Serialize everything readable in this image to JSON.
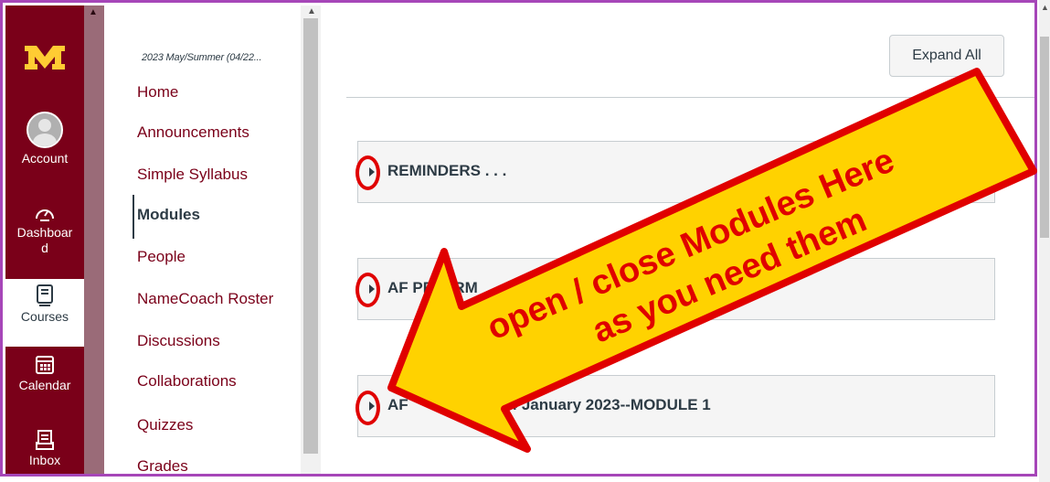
{
  "global_nav": {
    "account": "Account",
    "dashboard": "Dashboard",
    "courses": "Courses",
    "calendar": "Calendar",
    "inbox": "Inbox"
  },
  "course_nav": {
    "term": "2023 May/Summer (04/22...",
    "items": [
      {
        "label": "Home"
      },
      {
        "label": "Announcements"
      },
      {
        "label": "Simple Syllabus"
      },
      {
        "label": "Modules",
        "active": true
      },
      {
        "label": "People"
      },
      {
        "label": "NameCoach Roster"
      },
      {
        "label": "Discussions"
      },
      {
        "label": "Collaborations"
      },
      {
        "label": "Quizzes"
      },
      {
        "label": "Grades"
      }
    ]
  },
  "main": {
    "expand_all": "Expand All",
    "modules": [
      {
        "title": "REMINDERS . . ."
      },
      {
        "title": "AF PR",
        "title_tail": "ERM"
      },
      {
        "title": "AF",
        "title_tail": "4 January 2023--MODULE 1"
      }
    ]
  },
  "annotation": {
    "line1": "open / close Modules Here",
    "line2": "as you need them",
    "arrow_fill": "#ffd200",
    "arrow_stroke": "#e00000",
    "text_color": "#e00000"
  },
  "colors": {
    "brand": "#7a0019",
    "highlight_frame": "#a646b8"
  }
}
